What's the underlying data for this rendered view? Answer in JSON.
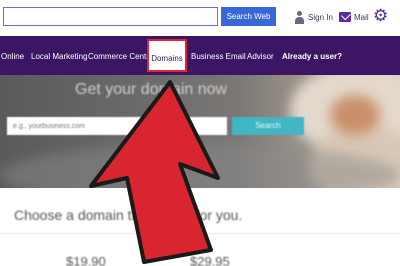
{
  "header": {
    "search": {
      "value": "",
      "placeholder": ""
    },
    "search_button": "Search Web",
    "sign_in": "Sign In",
    "mail": "Mail",
    "sign_in_icon": "user-icon",
    "mail_icon": "envelope-icon",
    "settings_icon": "gear-icon"
  },
  "nav": {
    "items": [
      "Online",
      "Local Marketing",
      "Commerce Centra",
      "Domains",
      "Business Email",
      "Advisor"
    ],
    "cta": "Already a user?",
    "highlighted": "Domains"
  },
  "hero": {
    "title": "Get your domain now",
    "search": {
      "placeholder": "e.g., yourbusiness.com",
      "value": ""
    },
    "search_button": "Search"
  },
  "section": {
    "heading": "Choose a domain that's right for you.",
    "prices": [
      "$19.90",
      "$29.95"
    ]
  },
  "colors": {
    "nav_bg": "#3c1565",
    "highlight_border": "#e02438",
    "arrow_fill": "#d9252f",
    "search_button": "#3a67d8",
    "hero_search_button": "#42b6c4"
  }
}
